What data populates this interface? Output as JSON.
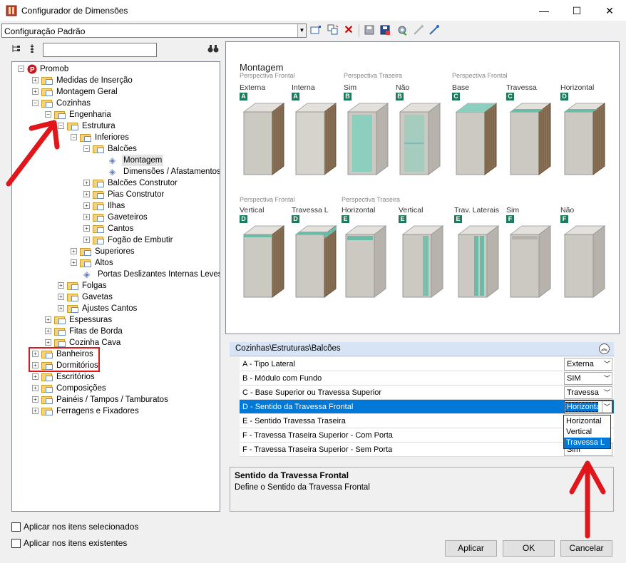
{
  "window": {
    "title": "Configurador de Dimensões",
    "minimize": "—",
    "maximize": "☐",
    "close": "✕"
  },
  "config_combo": {
    "value": "Configuração Padrão"
  },
  "tree_search": {
    "value": ""
  },
  "tree": {
    "root": "Promob",
    "items": [
      "Medidas de Inserção",
      "Montagem Geral",
      "Cozinhas",
      "Engenharia",
      "Estrutura",
      "Inferiores",
      "Balcões",
      "Montagem",
      "Dimensões / Afastamentos",
      "Balcões Construtor",
      "Pias Construtor",
      "Ilhas",
      "Gaveteiros",
      "Cantos",
      "Fogão de Embutir",
      "Superiores",
      "Altos",
      "Portas Deslizantes Internas Leves",
      "Folgas",
      "Gavetas",
      "Ajustes Cantos",
      "Espessuras",
      "Fitas de Borda",
      "Cozinha Cava",
      "Banheiros",
      "Dormitórios",
      "Escritórios",
      "Composições",
      "Painéis / Tampos / Tamburatos",
      "Ferragens e Fixadores"
    ]
  },
  "preview": {
    "heading": "Montagem",
    "row1_sections": [
      "Perspectiva Frontal",
      "Perspectiva Traseira",
      "Perspectiva Frontal"
    ],
    "row2_sections": [
      "Perspectiva Frontal",
      "Perspectiva Traseira"
    ],
    "row1": [
      {
        "label": "Externa",
        "badge": "A"
      },
      {
        "label": "Interna",
        "badge": "A"
      },
      {
        "label": "Sim",
        "badge": "B"
      },
      {
        "label": "Não",
        "badge": "B"
      },
      {
        "label": "Base",
        "badge": "C"
      },
      {
        "label": "Travessa",
        "badge": "C"
      },
      {
        "label": "Horizontal",
        "badge": "D"
      }
    ],
    "row2": [
      {
        "label": "Vertical",
        "badge": "D"
      },
      {
        "label": "Travessa L",
        "badge": "D"
      },
      {
        "label": "Horizontal",
        "badge": "E"
      },
      {
        "label": "Vertical",
        "badge": "E"
      },
      {
        "label": "Trav. Laterais",
        "badge": "E"
      },
      {
        "label": "Sim",
        "badge": "F"
      },
      {
        "label": "Não",
        "badge": "F"
      }
    ]
  },
  "properties": {
    "path": "Cozinhas\\Estruturas\\Balcões",
    "rows": [
      {
        "label": "A - Tipo Lateral",
        "value": "Externa"
      },
      {
        "label": "B - Módulo com Fundo",
        "value": "SIM"
      },
      {
        "label": "C - Base Superior ou Travessa Superior",
        "value": "Travessa"
      },
      {
        "label": "D - Sentido da Travessa Frontal",
        "value": "Horizontal"
      },
      {
        "label": "E - Sentido Travessa Traseira",
        "value": ""
      },
      {
        "label": "F - Travessa Traseira Superior - Com Porta",
        "value": ""
      },
      {
        "label": "F - Travessa Traseira Superior - Sem Porta",
        "value": "Sim"
      }
    ],
    "dropdown_options": [
      "Horizontal",
      "Vertical",
      "Travessa L"
    ]
  },
  "description": {
    "title": "Sentido da Travessa Frontal",
    "text": "Define o Sentido da Travessa Frontal"
  },
  "options": {
    "apply_selected": "Aplicar nos itens selecionados",
    "apply_existing": "Aplicar nos itens existentes"
  },
  "buttons": {
    "apply": "Aplicar",
    "ok": "OK",
    "cancel": "Cancelar"
  },
  "colors": {
    "accent": "#0078d7",
    "annotation_red": "#e0161b",
    "badge_green": "#1e7a5b"
  }
}
